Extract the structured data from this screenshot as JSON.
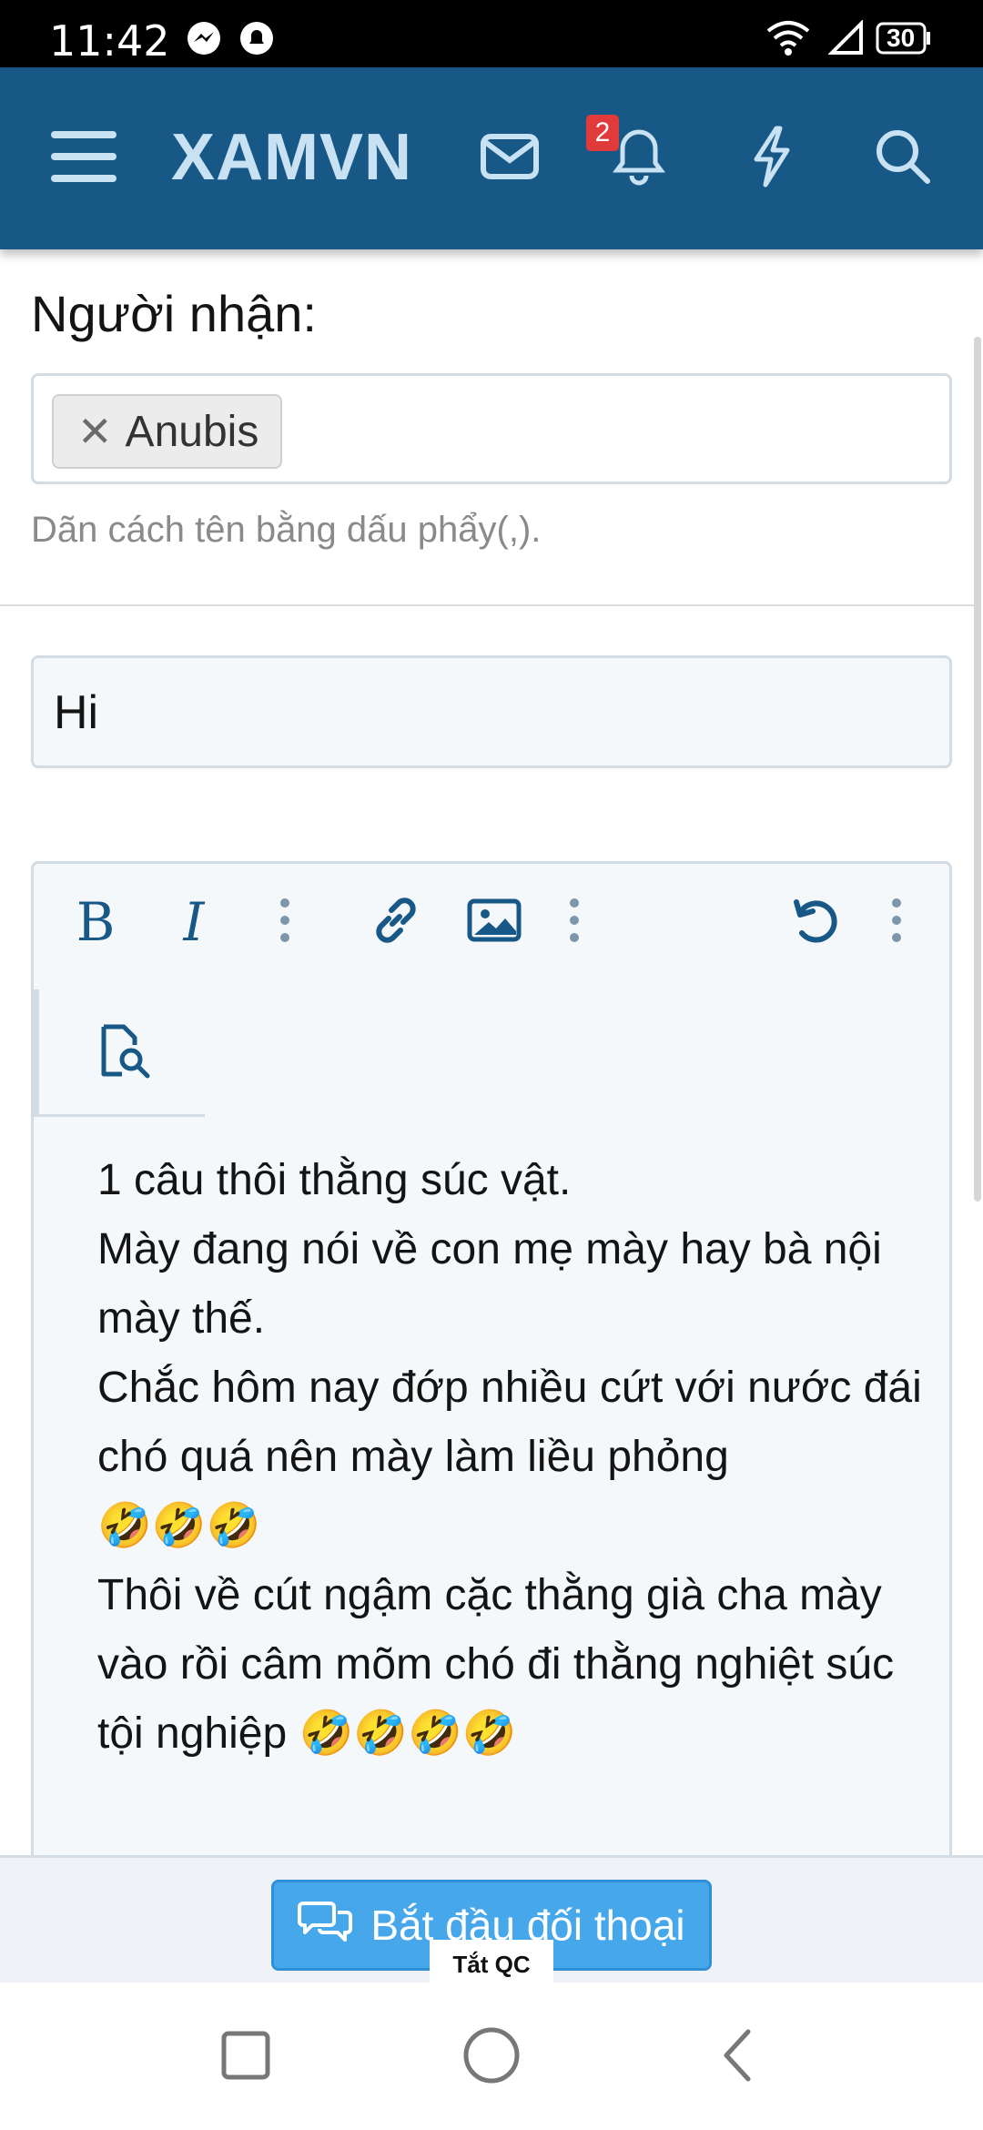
{
  "status_bar": {
    "time": "11:42",
    "battery": "30",
    "icons": [
      "messenger-icon",
      "notification-app-icon",
      "wifi-icon",
      "signal-icon",
      "battery-icon"
    ]
  },
  "header": {
    "brand": "XAMVN",
    "notification_count": "2",
    "icons": [
      "menu-icon",
      "mail-icon",
      "bell-icon",
      "bolt-icon",
      "search-icon"
    ],
    "background_color": "#185886",
    "brand_color": "#c8e2f3"
  },
  "recipients": {
    "label": "Người nhận:",
    "tokens": [
      {
        "name": "Anubis"
      }
    ],
    "hint": "Dãn cách tên bằng dấu phẩy(,)."
  },
  "title_field": {
    "value": "Hi"
  },
  "editor": {
    "toolbar": [
      "bold-icon",
      "italic-icon",
      "more-options-icon",
      "link-icon",
      "image-icon",
      "more-options-icon",
      "undo-icon",
      "more-options-icon",
      "preview-icon"
    ],
    "content": "1 câu thôi thằng súc vật.\nMày đang nói về con mẹ mày hay bà nội mày thế.\nChắc hôm nay đớp nhiều cứt với nước đái chó quá nên mày làm liều phỏng\n🤣🤣🤣\nThôi về cút ngậm cặc thằng già cha mày vào rồi câm mõm chó đi thằng nghiệt súc tội nghiệp 🤣🤣🤣🤣"
  },
  "actions": {
    "start_conversation": "Bắt đầu đối thoại",
    "ad_toggle": "Tắt QC",
    "button_color": "#47a7eb"
  },
  "nav_bar": {
    "icons": [
      "recent-apps-icon",
      "home-icon",
      "back-icon"
    ]
  }
}
